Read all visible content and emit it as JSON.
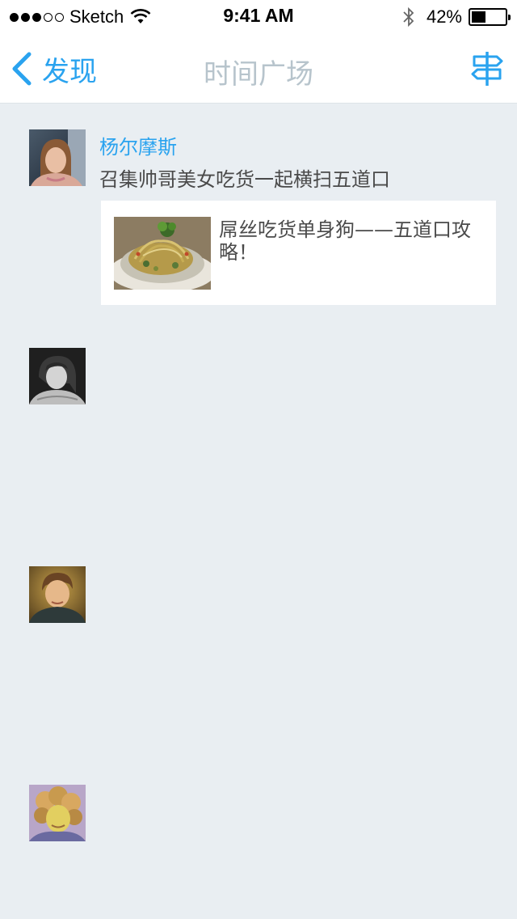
{
  "status_bar": {
    "signal_filled": 3,
    "signal_total": 5,
    "carrier": "Sketch",
    "time": "9:41 AM",
    "battery_percent": "42%",
    "battery_level": 0.42
  },
  "nav": {
    "back_label": "发现",
    "title": "时间广场",
    "action_icon": "signpost-icon"
  },
  "feed": {
    "posts": [
      {
        "username": "杨尔摩斯",
        "text": "召集帅哥美女吃货一起横扫五道口",
        "share": {
          "title": "屌丝吃货单身狗——五道口攻略！"
        }
      }
    ]
  },
  "colors": {
    "accent": "#2aa3ef",
    "title_gray": "#b7c4cc",
    "background": "#e9eef2",
    "text": "#4a4a4a"
  }
}
